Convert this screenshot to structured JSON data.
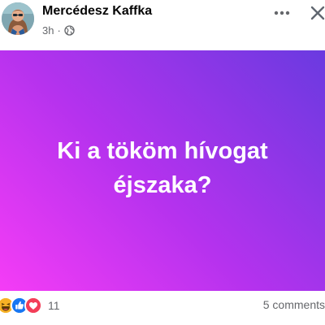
{
  "post": {
    "author": {
      "name": "Mercédesz Kaffka",
      "avatar_icon": "profile-photo"
    },
    "timestamp": "3h",
    "separator": "·",
    "privacy_icon": "globe-icon",
    "more_icon": "more-horizontal-icon",
    "close_icon": "close-icon",
    "text": "Ki a tököm hívogat éjszaka?",
    "background": {
      "gradient_colors": [
        "#f53cf6",
        "#b532ee",
        "#6a3ae0"
      ],
      "text_color": "#ffffff"
    },
    "reactions": {
      "icons": [
        "haha-icon",
        "like-icon",
        "love-icon"
      ],
      "count": "11"
    },
    "comments": "5 comments"
  }
}
